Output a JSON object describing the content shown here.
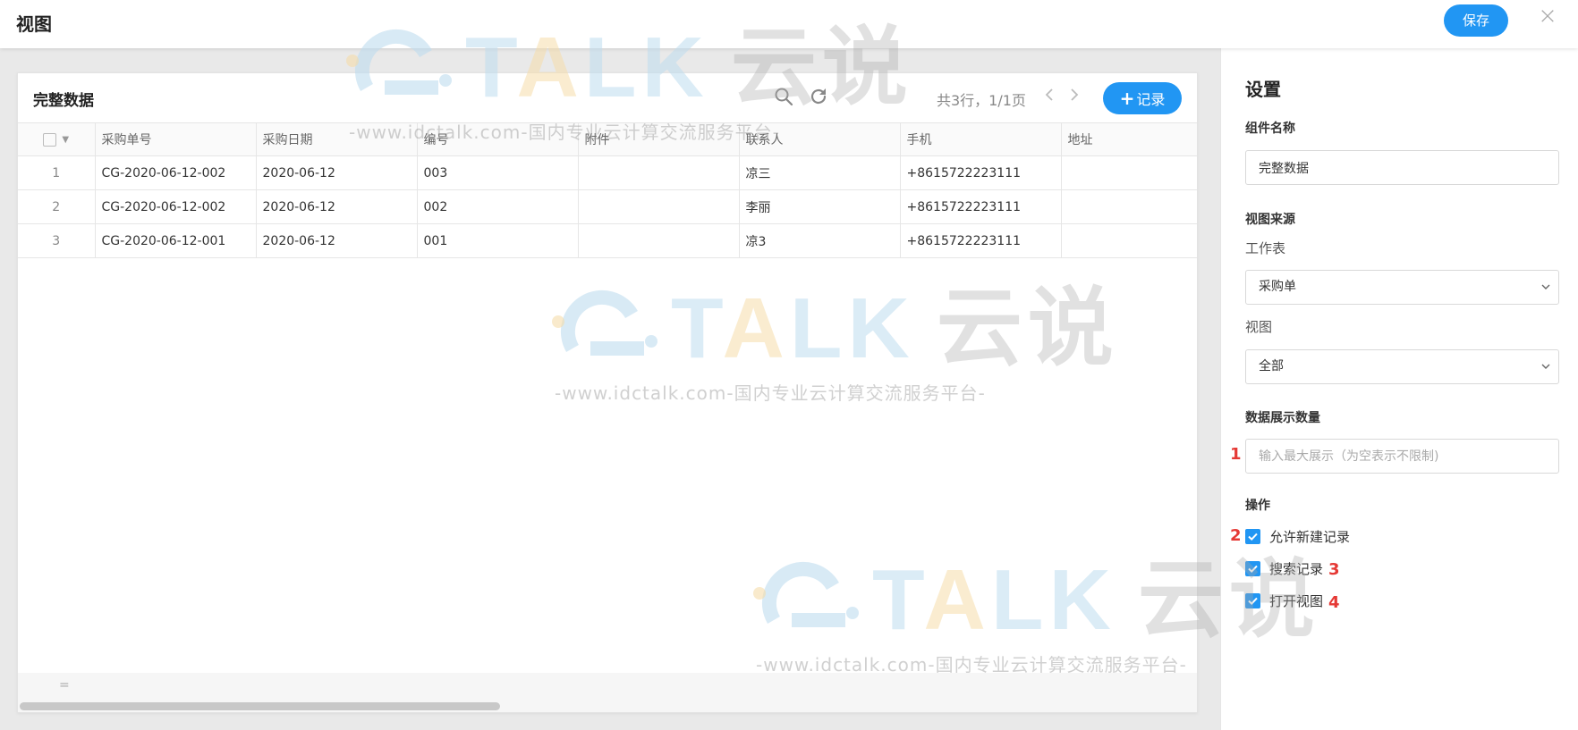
{
  "header": {
    "title": "视图",
    "save_label": "保存",
    "close_glyph": "×"
  },
  "card": {
    "title": "完整数据",
    "count_text": "共3行，1/1页",
    "add_label": "记录",
    "add_glyph": "+",
    "footer_glyph": "=",
    "icons": [
      "search-icon",
      "refresh-icon",
      "chevron-left-icon",
      "chevron-right-icon"
    ]
  },
  "table": {
    "columns": [
      "采购单号",
      "采购日期",
      "编号",
      "附件",
      "联系人",
      "手机",
      "地址"
    ],
    "rows": [
      {
        "num": "1",
        "cells": [
          "CG-2020-06-12-002",
          "2020-06-12",
          "003",
          "",
          "凉三",
          "+8615722223111",
          ""
        ]
      },
      {
        "num": "2",
        "cells": [
          "CG-2020-06-12-002",
          "2020-06-12",
          "002",
          "",
          "李丽",
          "+8615722223111",
          ""
        ]
      },
      {
        "num": "3",
        "cells": [
          "CG-2020-06-12-001",
          "2020-06-12",
          "001",
          "",
          "凉3",
          "+8615722223111",
          ""
        ]
      }
    ]
  },
  "settings": {
    "title": "设置",
    "component_name_label": "组件名称",
    "component_name_value": "完整数据",
    "view_source_label": "视图来源",
    "worksheet_label": "工作表",
    "worksheet_value": "采购单",
    "view_label": "视图",
    "view_value": "全部",
    "display_count_label": "数据展示数量",
    "display_count_placeholder": "输入最大展示（为空表示不限制)",
    "actions_label": "操作",
    "options": [
      {
        "label": "允许新建记录",
        "checked": true
      },
      {
        "label": "搜索记录",
        "checked": true
      },
      {
        "label": "打开视图",
        "checked": true
      }
    ]
  },
  "annotations": [
    "1",
    "2",
    "3",
    "4"
  ],
  "watermark": {
    "logo_letters": [
      "T",
      "A",
      "L",
      "K"
    ],
    "logo_cn": "云说",
    "url": "-www.idctalk.com-国内专业云计算交流服务平台-"
  },
  "colors": {
    "accent": "#2196f3",
    "annotation": "#e53935"
  }
}
